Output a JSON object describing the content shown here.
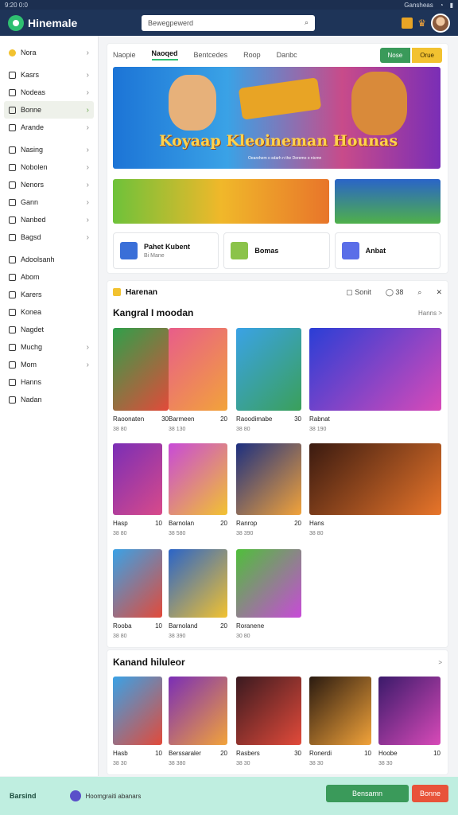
{
  "status": {
    "time": "9:20 0:0",
    "right": "Gansheas"
  },
  "app": {
    "title": "Hinemale"
  },
  "search": {
    "placeholder": "Bewegpewerd"
  },
  "sidebar": {
    "items": [
      {
        "label": "Nora",
        "chev": true
      },
      {
        "label": "Kasrs",
        "chev": true
      },
      {
        "label": "Nodeas",
        "chev": true
      },
      {
        "label": "Bonne",
        "chev": true,
        "active": true
      },
      {
        "label": "Arande",
        "chev": true
      },
      {
        "label": "Nasing",
        "chev": true
      },
      {
        "label": "Nobolen",
        "chev": true
      },
      {
        "label": "Nenors",
        "chev": true
      },
      {
        "label": "Gann",
        "chev": true
      },
      {
        "label": "Nanbed",
        "chev": true
      },
      {
        "label": "Bagsd",
        "chev": true
      },
      {
        "label": "Adoolsanh",
        "chev": false
      },
      {
        "label": "Abom",
        "chev": false
      },
      {
        "label": "Karers",
        "chev": false
      },
      {
        "label": "Konea",
        "chev": false
      },
      {
        "label": "Nagdet",
        "chev": false
      },
      {
        "label": "Muchg",
        "chev": true
      },
      {
        "label": "Mom",
        "chev": true
      },
      {
        "label": "Hanns",
        "chev": false
      },
      {
        "label": "Nadan",
        "chev": false
      }
    ]
  },
  "tabs": {
    "items": [
      "Naopie",
      "Naoqed",
      "Bentcedes",
      "Roop",
      "Danbc"
    ],
    "btn1": "Nose",
    "btn2": "Orue"
  },
  "banner": {
    "title": "Koyaap Kleoineman Hounas",
    "sub": "Oearehem o sdarh n the Deremo o nicmn"
  },
  "minis": [
    {
      "label": "Pahet Kubent",
      "sub": "Bi Mane"
    },
    {
      "label": "Bomas",
      "sub": ""
    },
    {
      "label": "Anbat",
      "sub": ""
    }
  ],
  "section1": {
    "title": "Harenan",
    "r1": "Sonit",
    "r2": "38",
    "heading": "Kangral I moodan",
    "more": "Hanns >"
  },
  "row1": [
    {
      "name": "Raoonaten",
      "val": "30",
      "sub": "38 80"
    },
    {
      "name": "Barmeen",
      "val": "20",
      "sub": "38 130"
    },
    {
      "name": "Raoodimabe",
      "val": "30",
      "sub": "38 80"
    },
    {
      "name": "Rabnat",
      "val": "",
      "sub": "38 190"
    }
  ],
  "row2": [
    {
      "name": "Hasp",
      "val": "10",
      "sub": "38 80"
    },
    {
      "name": "Barnolan",
      "val": "20",
      "sub": "38 580"
    },
    {
      "name": "Ranrop",
      "val": "20",
      "sub": "38 390"
    },
    {
      "name": "Hans",
      "val": "",
      "sub": "38 80"
    }
  ],
  "row3": [
    {
      "name": "Rooba",
      "val": "10",
      "sub": "38 80"
    },
    {
      "name": "Barnoland",
      "val": "20",
      "sub": "38 390"
    },
    {
      "name": "Roranene",
      "val": "",
      "sub": "30 80"
    }
  ],
  "section2": {
    "heading": "Kanand hiluleor",
    "more": ">"
  },
  "row4": [
    {
      "name": "Hasb",
      "val": "10",
      "sub": "38 30"
    },
    {
      "name": "Berssaraler",
      "val": "20",
      "sub": "38 380"
    },
    {
      "name": "Rasbers",
      "val": "30",
      "sub": "38 30"
    },
    {
      "name": "Ronerdi",
      "val": "10",
      "sub": "38 30"
    },
    {
      "name": "Hoobe",
      "val": "10",
      "sub": "38 30"
    }
  ],
  "bottom": {
    "left": "Barsind",
    "mid": "Hoomgraiti abanars",
    "b1": "Bensamn",
    "b2": "Bonne"
  },
  "colors": {
    "primary": "#1e3458",
    "accent": "#2fbf71",
    "button": "#3a9a5a",
    "danger": "#e8533a",
    "highlight": "#f2c230"
  }
}
